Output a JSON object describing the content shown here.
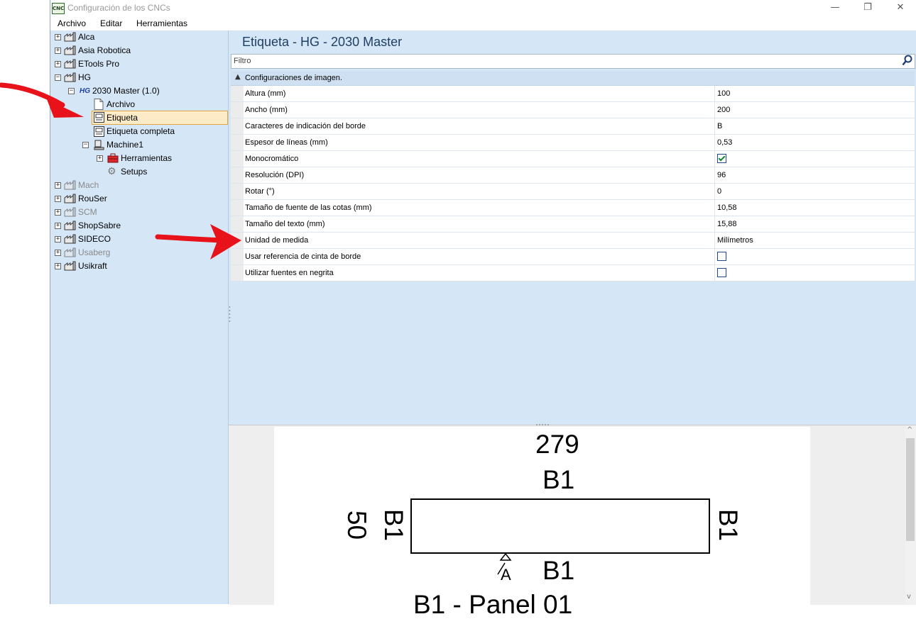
{
  "window": {
    "app_icon_text": "CNC",
    "title": "Configuración de los CNCs",
    "minimize": "—",
    "restore": "❐",
    "close": "✕"
  },
  "menu": [
    "Archivo",
    "Editar",
    "Herramientas"
  ],
  "tree": {
    "items": [
      {
        "label": "Alca",
        "expander": "+"
      },
      {
        "label": "Asia Robotica",
        "expander": "+"
      },
      {
        "label": "ETools Pro",
        "expander": "+"
      },
      {
        "label": "HG",
        "expander": "−"
      },
      {
        "label": "2030 Master (1.0)",
        "expander": "−",
        "badge": "HG"
      },
      {
        "label": "Archivo"
      },
      {
        "label": "Etiqueta"
      },
      {
        "label": "Etiqueta completa"
      },
      {
        "label": "Machine1",
        "expander": "−"
      },
      {
        "label": "Herramientas",
        "expander": "+"
      },
      {
        "label": "Setups"
      },
      {
        "label": "Mach",
        "expander": "+"
      },
      {
        "label": "RouSer",
        "expander": "+"
      },
      {
        "label": "SCM",
        "expander": "+"
      },
      {
        "label": "ShopSabre",
        "expander": "+"
      },
      {
        "label": "SIDECO",
        "expander": "+"
      },
      {
        "label": "Usaberg",
        "expander": "+"
      },
      {
        "label": "Usikraft",
        "expander": "+"
      }
    ]
  },
  "panel": {
    "title": "Etiqueta - HG - 2030 Master",
    "filter_placeholder": "Filtro",
    "section_toggle": "▲",
    "section_label": "Configuraciones de imagen.",
    "properties": [
      {
        "name": "Altura (mm)",
        "value": "100"
      },
      {
        "name": "Ancho (mm)",
        "value": "200"
      },
      {
        "name": "Caracteres de indicación del borde",
        "value": "B"
      },
      {
        "name": "Espesor de líneas (mm)",
        "value": "0,53"
      },
      {
        "name": "Monocromático",
        "checked": true
      },
      {
        "name": "Resolución (DPI)",
        "value": "96"
      },
      {
        "name": "Rotar (°)",
        "value": "0"
      },
      {
        "name": "Tamaño de fuente de las cotas (mm)",
        "value": "10,58"
      },
      {
        "name": "Tamaño del texto (mm)",
        "value": "15,88"
      },
      {
        "name": "Unidad de medida",
        "value": "Milímetros"
      },
      {
        "name": "Usar referencia de cinta de borde",
        "checked": false
      },
      {
        "name": "Utilizar fuentes en negrita",
        "checked": false
      }
    ]
  },
  "preview": {
    "dimension_top": "279",
    "edge_top": "B1",
    "dimension_left": "50",
    "edge_left": "B1",
    "edge_right": "B1",
    "edge_bottom": "B1",
    "grain_marker": "A",
    "bottom_line": "B1 - Panel 01"
  },
  "colors": {
    "arrow": "#e8121b",
    "tree_bg": "#d5e6f6",
    "selection": "#fcebc6"
  }
}
